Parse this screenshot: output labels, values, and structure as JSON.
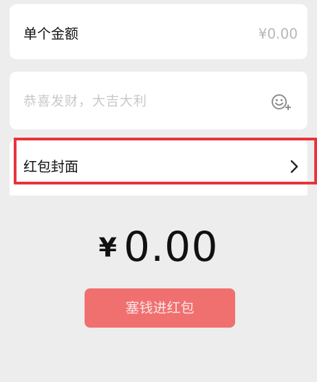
{
  "amount": {
    "label": "单个金额",
    "value": "¥0.00"
  },
  "greeting": {
    "placeholder": "恭喜发财，大吉大利",
    "emoji_icon": "emoji-add-icon"
  },
  "cover": {
    "label": "红包封面",
    "chevron_icon": "chevron-right-icon"
  },
  "total": {
    "currency": "¥",
    "value": "0.00"
  },
  "submit": {
    "label": "塞钱进红包"
  },
  "colors": {
    "highlight": "#e8333b",
    "button": "#f07070",
    "background": "#ededed"
  }
}
